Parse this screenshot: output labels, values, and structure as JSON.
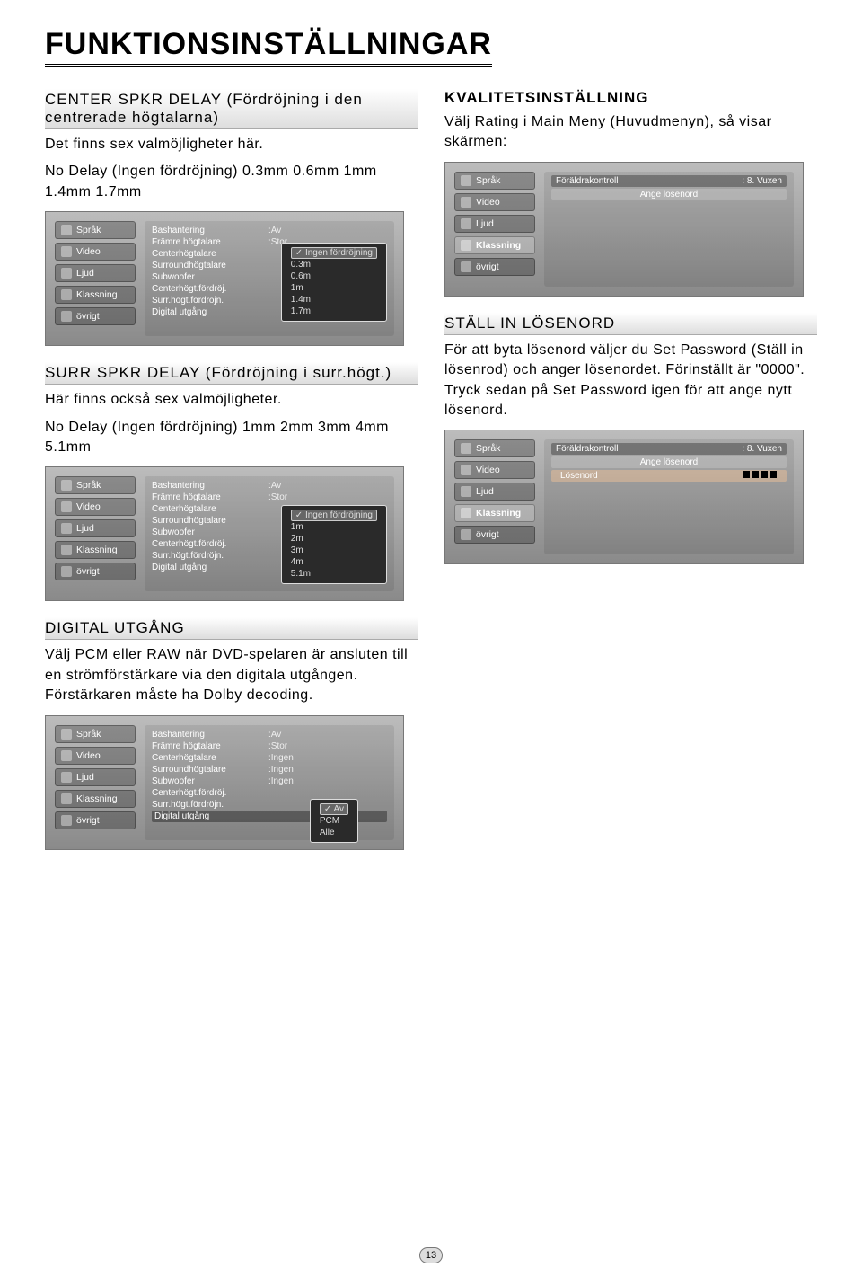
{
  "title": "FUNKTIONSINSTÄLLNINGAR",
  "pagenum": "13",
  "sidebar": {
    "items": [
      "Språk",
      "Video",
      "Ljud",
      "Klassning",
      "övrigt"
    ]
  },
  "center_delay": {
    "heading": "CENTER SPKR DELAY (Fördröjning i den centrerade högtalarna)",
    "line1": "Det finns sex valmöjligheter här.",
    "line2": "No Delay (Ingen fördröjning)   0.3mm   0.6mm   1mm   1.4mm   1.7mm"
  },
  "osd_rows": {
    "bash": "Bashantering",
    "bash_v": ":Av",
    "fram": "Främre högtalare",
    "fram_v": ":Stor",
    "center": "Centerhögtalare",
    "center_v": ":Ingen",
    "surr": "Surroundhögtalare",
    "surr_v": ":Ingen",
    "sub": "Subwoofer",
    "sub_v": ":Ingen",
    "cdel": "Centerhögt.fördröj.",
    "sdel": "Surr.högt.fördröjn.",
    "dig": "Digital utgång"
  },
  "popup_center": {
    "sel": "Ingen fördröjning",
    "o1": "0.3m",
    "o2": "0.6m",
    "o3": "1m",
    "o4": "1.4m",
    "o5": "1.7m"
  },
  "surr_delay": {
    "heading": "SURR SPKR DELAY (Fördröjning i surr.högt.)",
    "line1": "Här finns också sex valmöjligheter.",
    "line2": "No Delay (Ingen fördröjning) 1mm   2mm   3mm   4mm   5.1mm"
  },
  "popup_surr": {
    "sel": "Ingen fördröjning",
    "o1": "1m",
    "o2": "2m",
    "o3": "3m",
    "o4": "4m",
    "o5": "5.1m"
  },
  "digital_out": {
    "heading": "DIGITAL UTGÅNG",
    "text": "Välj PCM eller RAW när DVD-spelaren är ansluten till en strömförstärkare via den digitala utgången. Förstärkaren måste ha Dolby decoding."
  },
  "popup_dig": {
    "sel": "Av",
    "o1": "PCM",
    "o2": "Alle"
  },
  "rating": {
    "heading": "KVALITETSINSTÄLLNING",
    "text": "Välj Rating i Main Meny (Huvudmenyn), så visar skärmen:",
    "parent_lbl": "Föräldrakontroll",
    "parent_val": ": 8. Vuxen",
    "pw_lbl": "Ange lösenord",
    "pw_lbl2": "Lösenord"
  },
  "password": {
    "heading": "STÄLL IN LÖSENORD",
    "text": "För att byta lösenord väljer du Set Password (Ställ in lösenrod) och anger lösenordet. Förinställt är \"0000\". Tryck sedan på Set Password igen för att ange nytt lösenord."
  }
}
